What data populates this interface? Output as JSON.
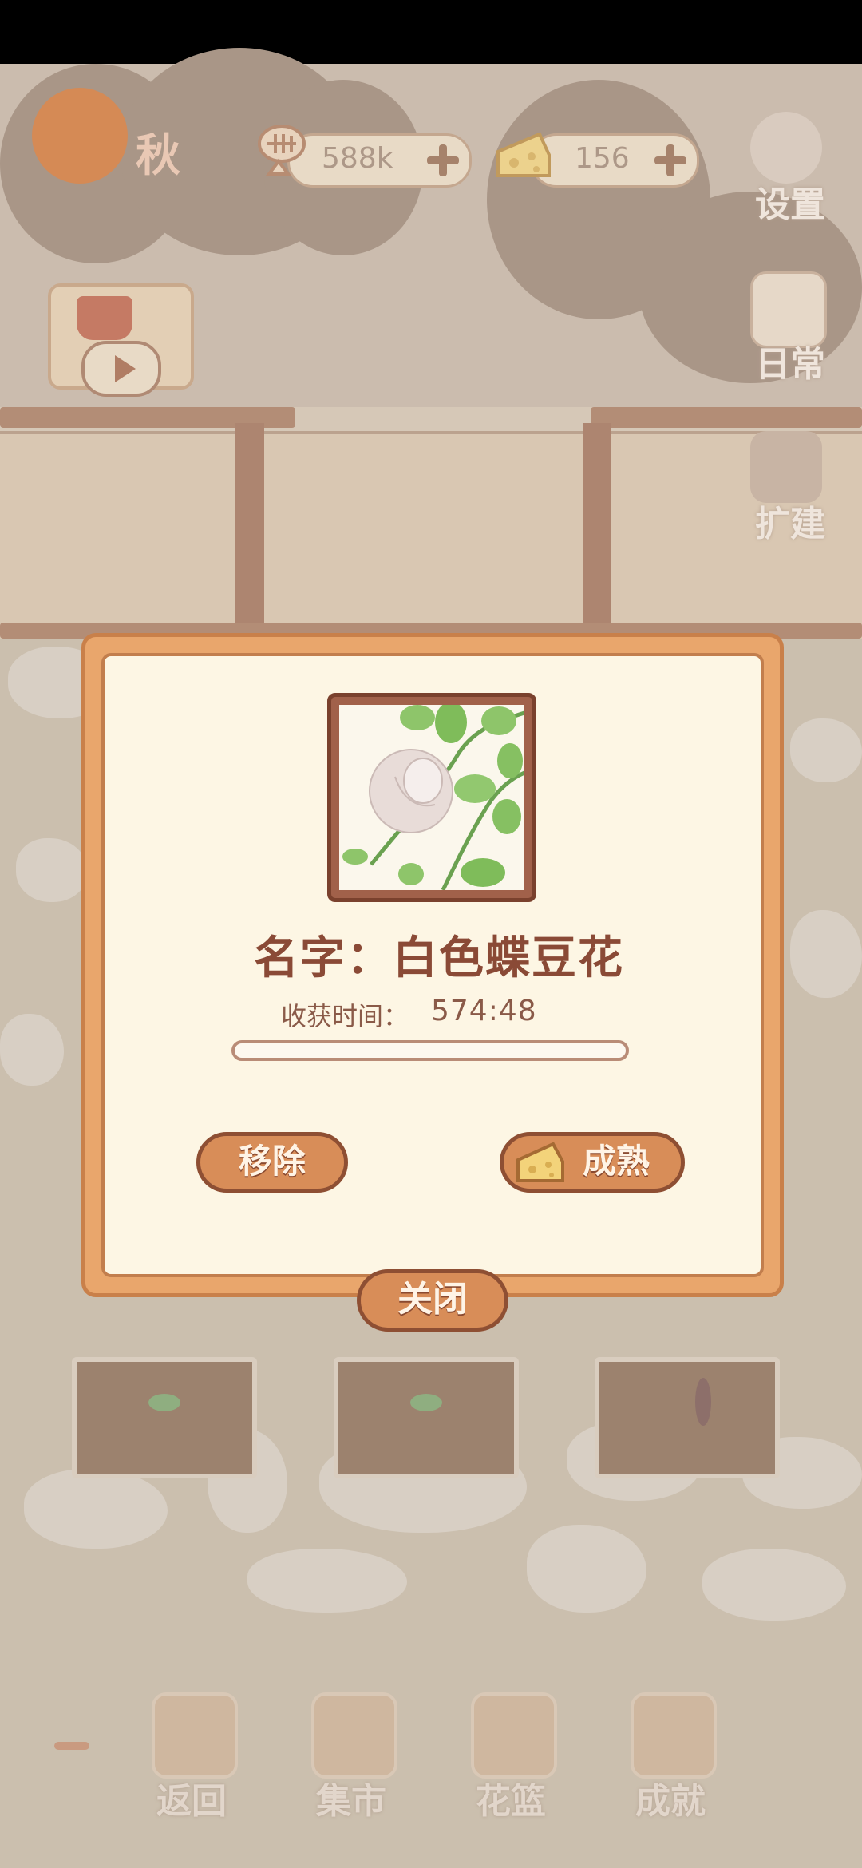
{
  "hud": {
    "season": "秋",
    "fish_amount": "588k",
    "cheese_amount": "156",
    "side_buttons": [
      "设置",
      "日常",
      "扩建"
    ]
  },
  "popup": {
    "name_prefix": "名字：",
    "flower_name": "白色蝶豆花",
    "harvest_label": "收获时间：",
    "harvest_time": "574:48",
    "progress": 0,
    "remove_label": "移除",
    "ripen_label": "成熟",
    "close_label": "关闭"
  },
  "bottom_nav": [
    "返回",
    "集市",
    "花篮",
    "成就"
  ]
}
